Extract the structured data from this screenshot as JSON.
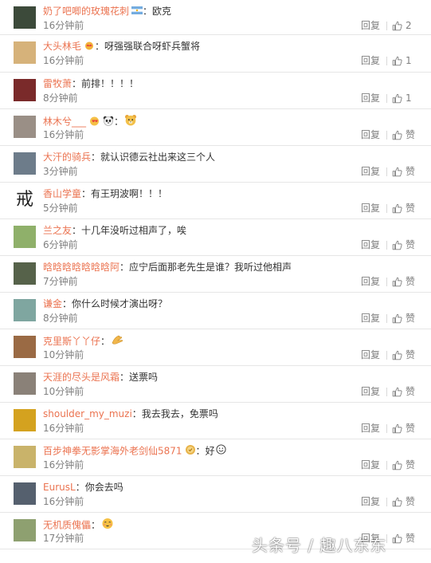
{
  "labels": {
    "reply": "回复",
    "like": "赞"
  },
  "watermark": "头条号 / 趣八东东",
  "comments": [
    {
      "name": "奶了吧唧的玫瑰花刺",
      "badge": "flag-icon",
      "text": "欧克",
      "time": "16分钟前",
      "likes": "2",
      "avatar_color": "#3c4a3a"
    },
    {
      "name": "大头林毛",
      "badge": "crown-icon",
      "text": "呀强强联合呀虾兵蟹将",
      "time": "16分钟前",
      "likes": "1",
      "avatar_color": "#d6b27a"
    },
    {
      "name": "雷牧萧",
      "text": "前排！！！！",
      "time": "8分钟前",
      "likes": "1",
      "avatar_color": "#7a2a2a"
    },
    {
      "name": "林木兮___",
      "badges": [
        "heart-emoji-icon",
        "panda-emoji-icon"
      ],
      "text": "",
      "text_emoji": "bear-face-emoji-icon",
      "time": "16分钟前",
      "likes": "赞",
      "avatar_color": "#9a8f86"
    },
    {
      "name": "大汗的骑兵",
      "text": "就认识德云社出来这三个人",
      "time": "3分钟前",
      "likes": "赞",
      "avatar_color": "#6d7c8a"
    },
    {
      "name": "香山学童",
      "text": "有王玥波啊！！！",
      "time": "5分钟前",
      "likes": "赞",
      "avatar_text": "戒",
      "avatar_color": "#ffffff"
    },
    {
      "name": "兰之友",
      "text": "十几年没听过相声了，唉",
      "time": "6分钟前",
      "likes": "赞",
      "avatar_color": "#8fb06a"
    },
    {
      "name": "晗晗晗晗晗晗晗阿",
      "text": "应宁后面那老先生是谁？我听过他相声",
      "time": "7分钟前",
      "likes": "赞",
      "avatar_color": "#56624a"
    },
    {
      "name": "谦金",
      "text": "你什么时候才演出呀？",
      "time": "8分钟前",
      "likes": "赞",
      "avatar_color": "#7fa6a0"
    },
    {
      "name": "克里斯丫丫仔",
      "text": "",
      "text_emoji": "clapping-hands-emoji-icon",
      "time": "10分钟前",
      "likes": "赞",
      "avatar_color": "#9a6a44"
    },
    {
      "name": "天涯的尽头是风霜",
      "text": "送票吗",
      "time": "10分钟前",
      "likes": "赞",
      "avatar_color": "#8a8178"
    },
    {
      "name": "shoulder_my_muzi",
      "text": "我去我去，免票吗",
      "time": "16分钟前",
      "likes": "赞",
      "avatar_color": "#d4a21f"
    },
    {
      "name": "百步神拳无影掌海外老剑仙5871",
      "badge": "gold-badge-icon",
      "text": "好",
      "text_emoji": "smiley-emoji-icon",
      "time": "16分钟前",
      "likes": "赞",
      "avatar_color": "#c9b36a"
    },
    {
      "name": "EurusL",
      "text": "你会去吗",
      "time": "16分钟前",
      "likes": "赞",
      "avatar_color": "#55606e"
    },
    {
      "name": "无机质傀儡",
      "text": "",
      "text_emoji": "blush-face-emoji-icon",
      "time": "17分钟前",
      "likes": "赞",
      "avatar_color": "#8ea070"
    }
  ]
}
